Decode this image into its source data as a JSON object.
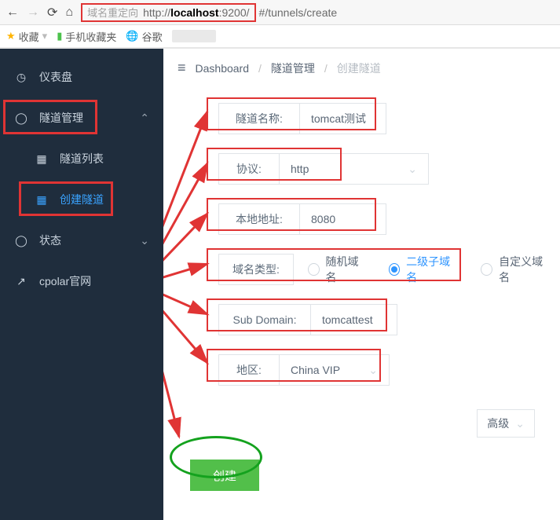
{
  "browser": {
    "redirect_label": "域名重定向",
    "url_prefix": "http://",
    "url_host": "localhost",
    "url_port": ":9200/",
    "url_hash": "#/tunnels/create"
  },
  "bookmarks": {
    "fav": "收藏",
    "mobile": "手机收藏夹",
    "item1": "谷歌"
  },
  "sidebar": {
    "dashboard": "仪表盘",
    "tunnel_mgmt": "隧道管理",
    "tunnel_list": "隧道列表",
    "tunnel_create": "创建隧道",
    "status": "状态",
    "cpolar": "cpolar官网"
  },
  "breadcrumb": {
    "root": "Dashboard",
    "mid": "隧道管理",
    "cur": "创建隧道"
  },
  "form": {
    "name_label": "隧道名称:",
    "name_value": "tomcat测试",
    "proto_label": "协议:",
    "proto_value": "http",
    "addr_label": "本地地址:",
    "addr_value": "8080",
    "domain_type_label": "域名类型:",
    "domain_random": "随机域名",
    "domain_sub": "二级子域名",
    "domain_custom": "自定义域名",
    "subdomain_label": "Sub Domain:",
    "subdomain_value": "tomcattest",
    "region_label": "地区:",
    "region_value": "China VIP",
    "advanced": "高级",
    "submit": "创建"
  }
}
